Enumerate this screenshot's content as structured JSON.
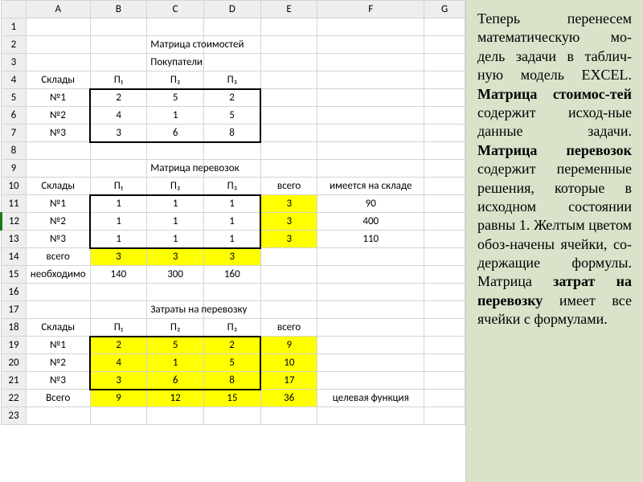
{
  "cols": [
    "A",
    "B",
    "C",
    "D",
    "E",
    "F",
    "G"
  ],
  "rows": [
    "1",
    "2",
    "3",
    "4",
    "5",
    "6",
    "7",
    "8",
    "9",
    "10",
    "11",
    "12",
    "13",
    "14",
    "15",
    "16",
    "17",
    "18",
    "19",
    "20",
    "21",
    "22",
    "23"
  ],
  "headers": {
    "title_cost": "Матрица стоимостей",
    "buyers": "Покупатели",
    "warehouses": "Склады",
    "p1": "П₁",
    "p2": "П₂",
    "p3": "П₃",
    "title_transport": "Матрица перевозок",
    "total": "всего",
    "in_stock": "имеется на складе",
    "required": "необходимо",
    "title_costs": "Затраты на перевозку",
    "big_total": "Всего",
    "objective": "целевая функция"
  },
  "cost_matrix": {
    "rows": [
      "№1",
      "№2",
      "№3"
    ],
    "values": [
      [
        2,
        5,
        2
      ],
      [
        4,
        1,
        5
      ],
      [
        3,
        6,
        8
      ]
    ]
  },
  "transport_matrix": {
    "rows": [
      "№1",
      "№2",
      "№3"
    ],
    "values": [
      [
        1,
        1,
        1
      ],
      [
        1,
        1,
        1
      ],
      [
        1,
        1,
        1
      ]
    ],
    "row_totals": [
      3,
      3,
      3
    ],
    "col_totals": [
      3,
      3,
      3
    ],
    "stock": [
      90,
      400,
      110
    ],
    "demand": [
      140,
      300,
      160
    ]
  },
  "expense_matrix": {
    "rows": [
      "№1",
      "№2",
      "№3"
    ],
    "values": [
      [
        2,
        5,
        2
      ],
      [
        4,
        1,
        5
      ],
      [
        3,
        6,
        8
      ]
    ],
    "row_totals": [
      9,
      10,
      17
    ],
    "col_totals": [
      9,
      12,
      15
    ],
    "grand_total": 36
  },
  "sidebar_text": {
    "p1a": "Теперь перенесем математическую мо-дель задачи в таблич-ную модель EXCEL.",
    "p1b_bold": "Матрица стоимос-тей",
    "p1b_rest": " содержит исход-ные данные задачи.",
    "p2_bold": "Матрица перевозок",
    "p2_rest": " содержит переменные решения, которые в исходном состоянии равны 1.",
    "p3": "Желтым цветом обоз-начены ячейки, со-держащие формулы.",
    "p4a": "Матрица ",
    "p4_bold": "затрат на перевозку",
    "p4b": " имеет все ячейки с формулами."
  }
}
